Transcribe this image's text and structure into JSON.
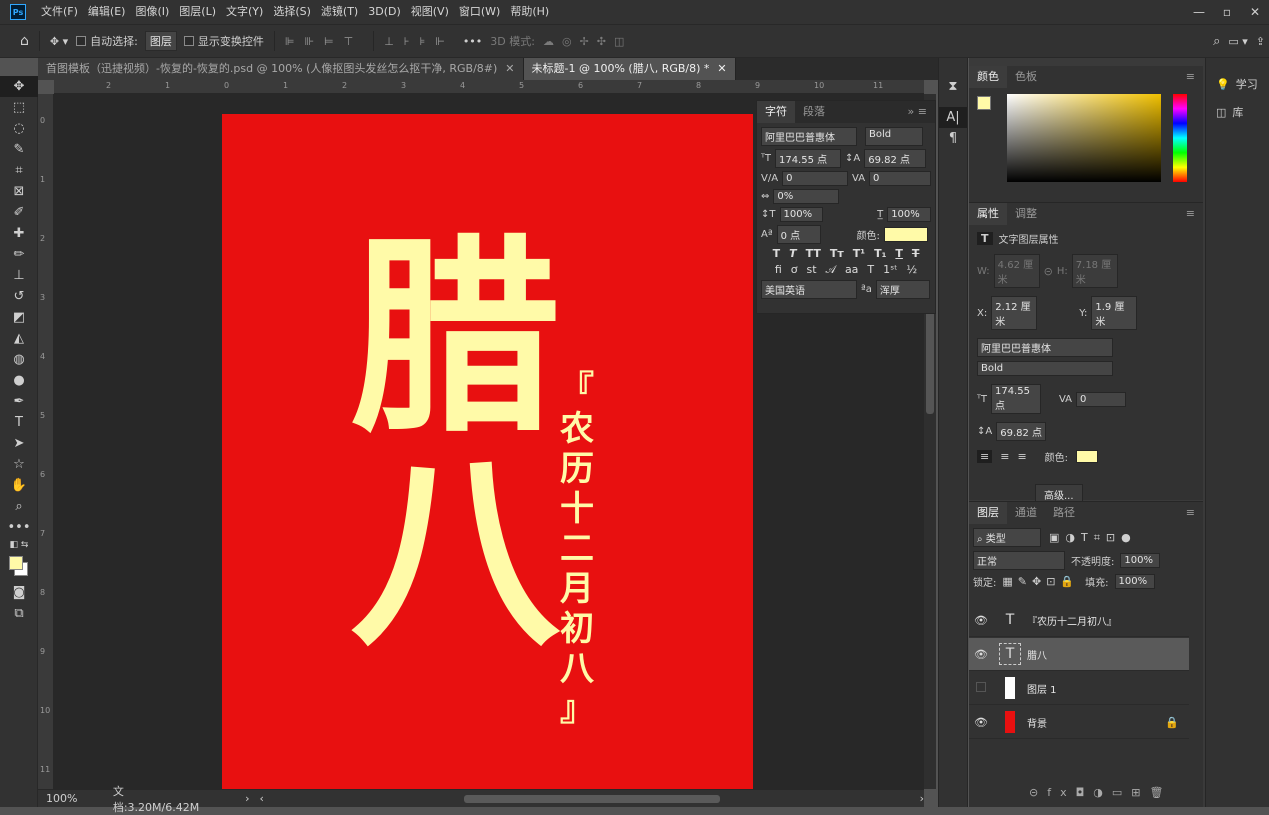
{
  "menu": [
    "文件(F)",
    "编辑(E)",
    "图像(I)",
    "图层(L)",
    "文字(Y)",
    "选择(S)",
    "滤镜(T)",
    "3D(D)",
    "视图(V)",
    "窗口(W)",
    "帮助(H)"
  ],
  "options": {
    "auto_select": "自动选择:",
    "layer_dd": "图层",
    "show_transform": "显示变换控件",
    "mode_3d": "3D 模式:"
  },
  "tabs": [
    {
      "label": "首图模板（迅捷视频）-恢复的-恢复的.psd @ 100% (人像抠图头发丝怎么抠干净, RGB/8#)"
    },
    {
      "label": "未标题-1 @ 100% (腊八, RGB/8) *"
    }
  ],
  "ruler_h": [
    "2",
    "1",
    "0",
    "1",
    "2",
    "3",
    "4",
    "5",
    "6",
    "7",
    "8",
    "9",
    "10",
    "11"
  ],
  "ruler_v": [
    "0",
    "1",
    "2",
    "3",
    "4",
    "5",
    "6",
    "7",
    "8",
    "9",
    "10",
    "11"
  ],
  "canvas": {
    "big_char_1": "腊",
    "big_char_2": "八",
    "vertical_text": "『农历十二月初八』",
    "bg_color": "#e81010",
    "text_color": "#fffaa8"
  },
  "status": {
    "zoom": "100%",
    "doc": "文档:3.20M/6.42M"
  },
  "char_panel": {
    "tab_char": "字符",
    "tab_para": "段落",
    "font": "阿里巴巴普惠体",
    "weight": "Bold",
    "size": "174.55 点",
    "leading": "69.82 点",
    "kerning": "0",
    "tracking": "0",
    "scale_pct": "0%",
    "v_scale": "100%",
    "h_scale": "100%",
    "baseline": "0 点",
    "color_label": "颜色:",
    "lang": "美国英语",
    "aa": "浑厚"
  },
  "color_panel": {
    "tab_color": "颜色",
    "tab_swatch": "色板"
  },
  "props_panel": {
    "tab_props": "属性",
    "tab_adjust": "调整",
    "title": "文字图层属性",
    "w_label": "W:",
    "w": "4.62 厘米",
    "h_label": "H:",
    "h": "7.18 厘米",
    "x_label": "X:",
    "x": "2.12 厘米",
    "y_label": "Y:",
    "y": "1.9 厘米",
    "font": "阿里巴巴普惠体",
    "weight": "Bold",
    "size": "174.55 点",
    "tracking": "0",
    "leading": "69.82 点",
    "color_label": "颜色:",
    "advanced": "高级..."
  },
  "layers_panel": {
    "tab_layers": "图层",
    "tab_channels": "通道",
    "tab_paths": "路径",
    "kind": "类型",
    "blend": "正常",
    "opacity_label": "不透明度:",
    "opacity": "100%",
    "lock_label": "锁定:",
    "fill_label": "填充:",
    "fill": "100%",
    "layers": [
      {
        "name": "『农历十二月初八』",
        "type": "text"
      },
      {
        "name": "腊八",
        "type": "text"
      },
      {
        "name": "图层 1",
        "type": "pixel"
      },
      {
        "name": "背景",
        "type": "bg"
      }
    ]
  },
  "far_right": {
    "learn": "学习",
    "library": "库"
  }
}
